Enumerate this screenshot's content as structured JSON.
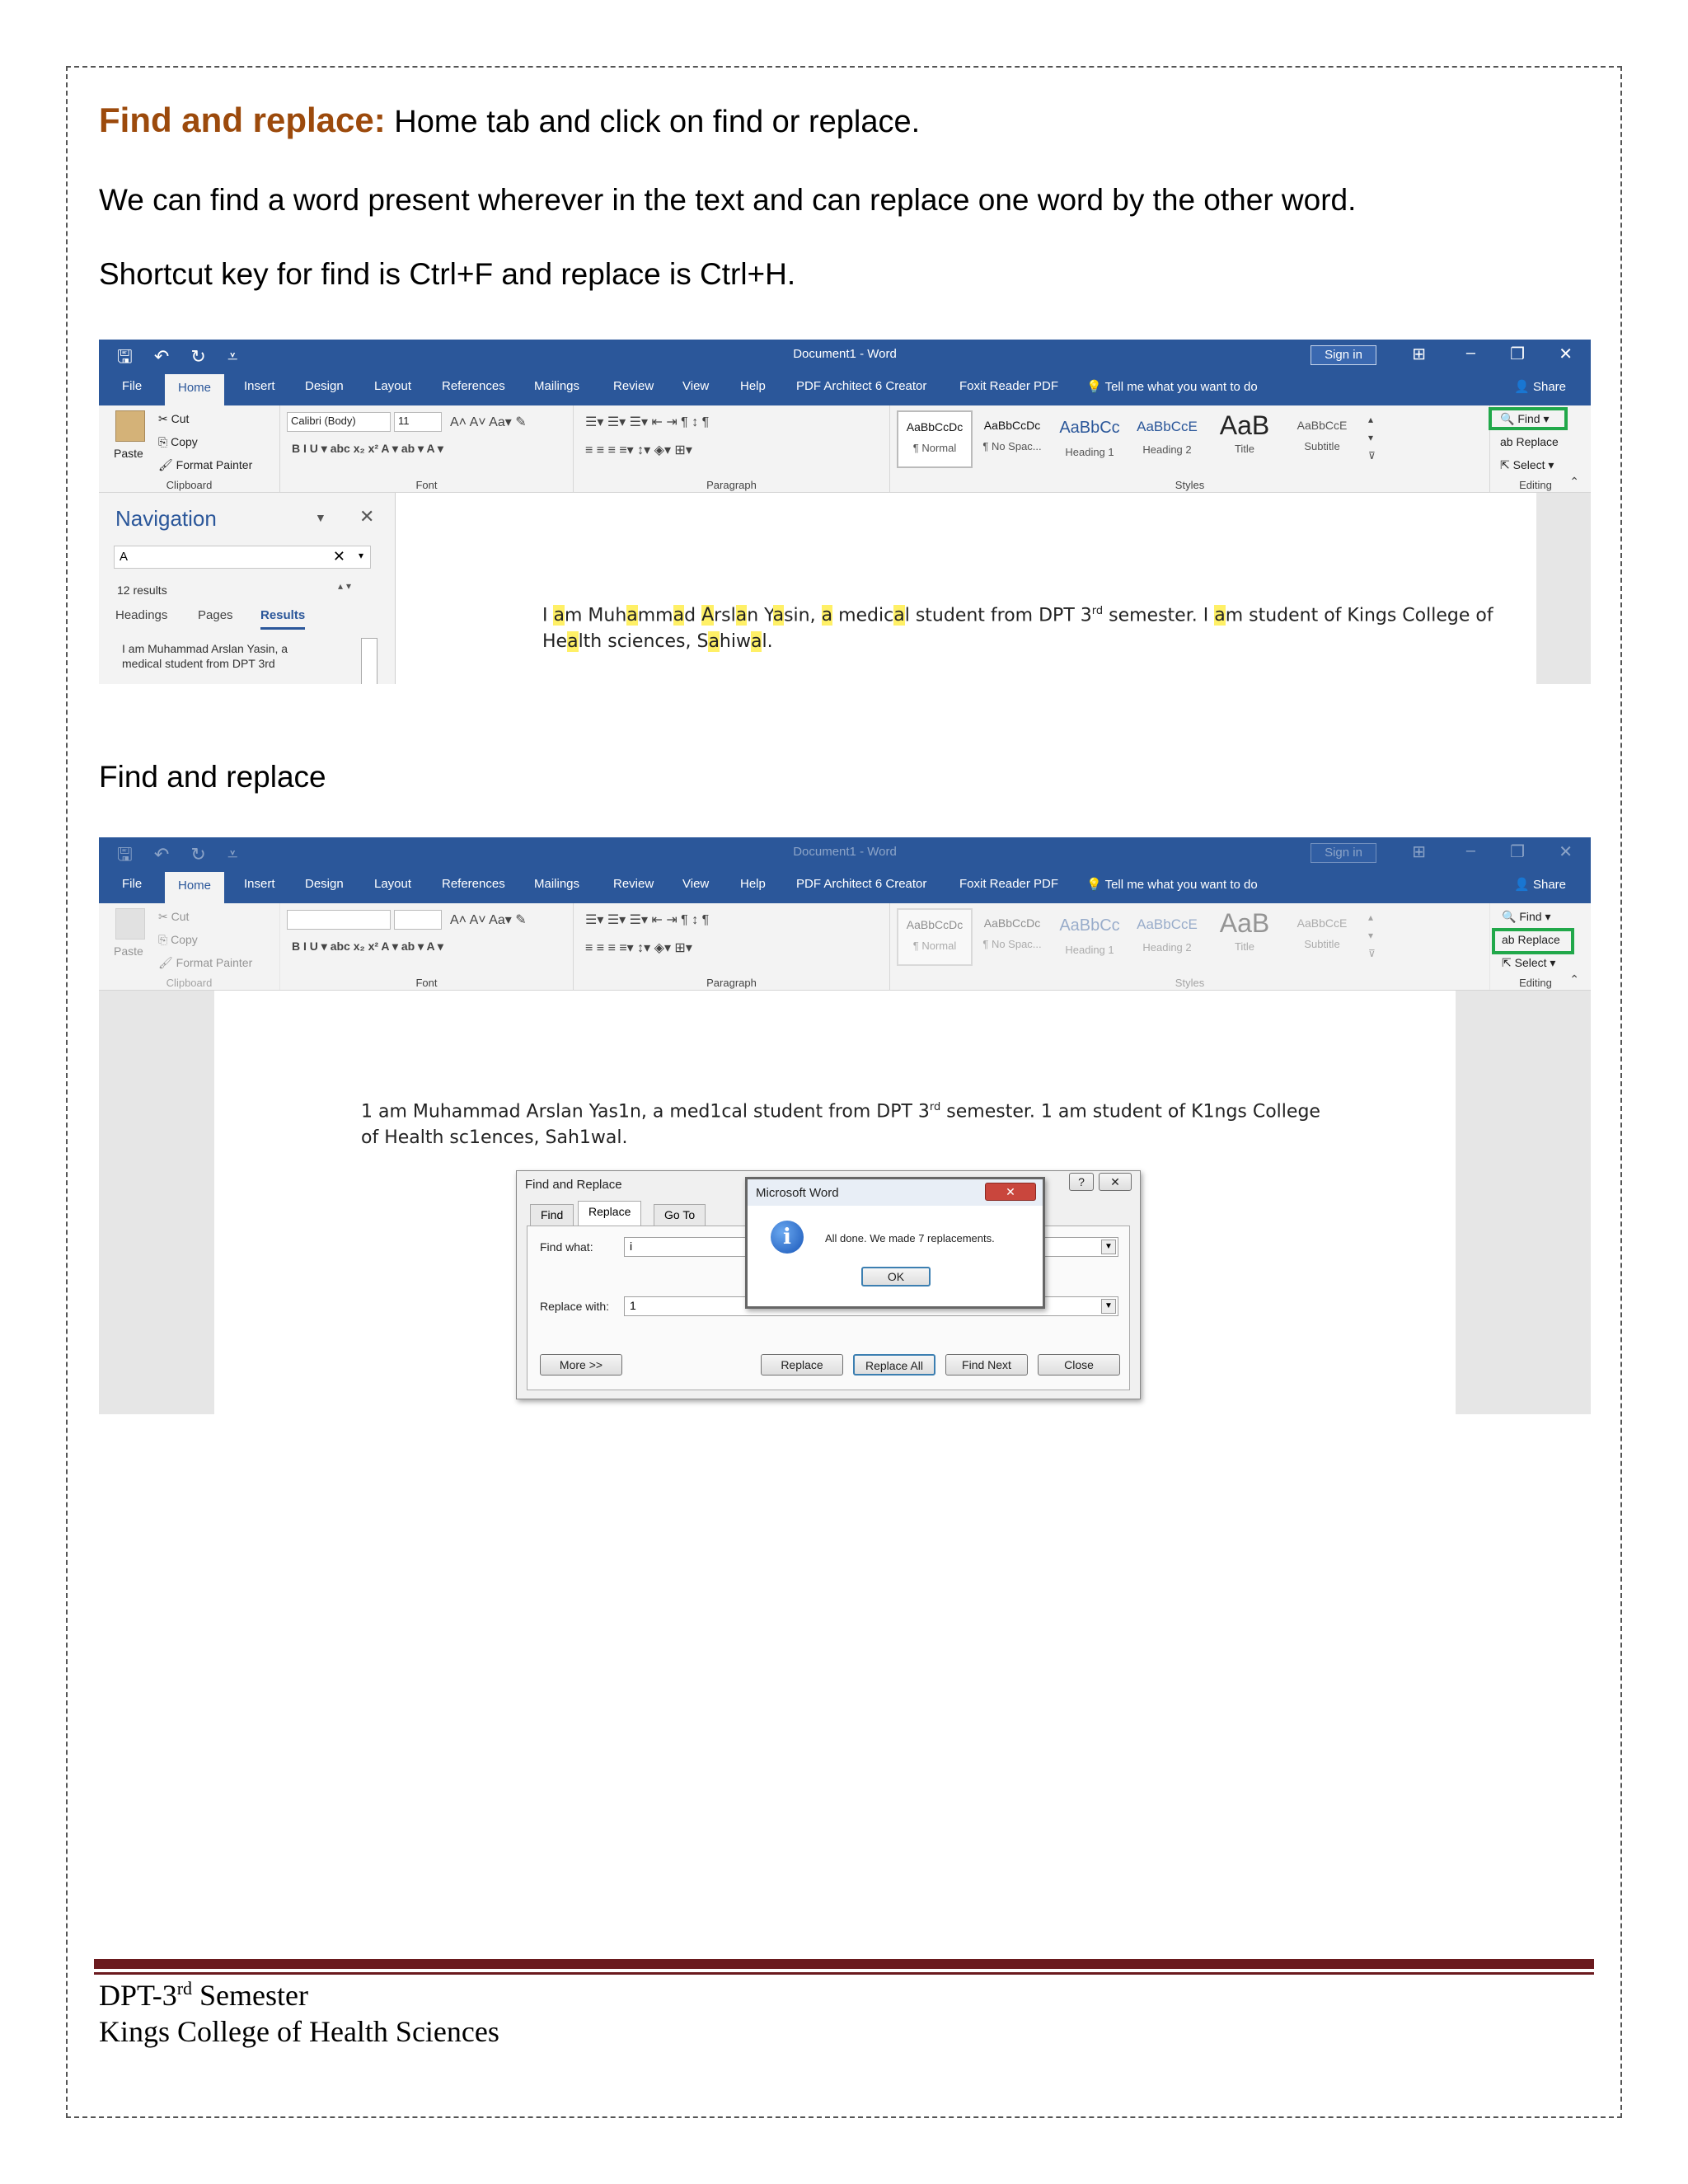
{
  "heading": {
    "highlight": "Find and replace:",
    "rest": " Home tab and click on find or replace."
  },
  "para1": "We can find a word present wherever in the text and can replace one word by the other word.",
  "para2": "Shortcut key for find is Ctrl+F and replace is Ctrl+H.",
  "caption": "Find and replace",
  "word": {
    "doc_title": "Document1  -  Word",
    "sign_in": "Sign in",
    "tabs": [
      "File",
      "Home",
      "Insert",
      "Design",
      "Layout",
      "References",
      "Mailings",
      "Review",
      "View",
      "Help",
      "PDF Architect 6 Creator",
      "Foxit Reader PDF"
    ],
    "tell_me": "Tell me what you want to do",
    "share": "Share",
    "clipboard": {
      "paste": "Paste",
      "cut": "Cut",
      "copy": "Copy",
      "format_painter": "Format Painter",
      "label": "Clipboard"
    },
    "font": {
      "name": "Calibri (Body)",
      "size": "11",
      "label": "Font"
    },
    "paragraph_label": "Paragraph",
    "styles": [
      {
        "sample": "AaBbCcDc",
        "name": "¶ Normal"
      },
      {
        "sample": "AaBbCcDc",
        "name": "¶ No Spac..."
      },
      {
        "sample": "AaBbCc",
        "name": "Heading 1"
      },
      {
        "sample": "AaBbCcE",
        "name": "Heading 2"
      },
      {
        "sample": "AaB",
        "name": "Title"
      },
      {
        "sample": "AaBbCcE",
        "name": "Subtitle"
      }
    ],
    "styles_label": "Styles",
    "editing": {
      "find": "Find",
      "replace": "Replace",
      "select": "Select",
      "label": "Editing"
    }
  },
  "nav": {
    "title": "Navigation",
    "search": "A",
    "results": "12 results",
    "tabs": [
      "Headings",
      "Pages",
      "Results"
    ],
    "snippet": "I am Muhammad Arslan Yasin, a medical student from DPT 3rd"
  },
  "doc1": {
    "l1_parts": [
      "I ",
      "a",
      "m Muh",
      "a",
      "mm",
      "a",
      "d ",
      "A",
      "rsl",
      "a",
      "n Y",
      "a",
      "sin, ",
      "a",
      " medic",
      "a",
      "l student from DPT 3",
      "rd",
      " semester. I ",
      "a",
      "m student of Kings College of"
    ],
    "l2_parts": [
      "He",
      "a",
      "lth sciences, S",
      "a",
      "hiw",
      "a",
      "l."
    ]
  },
  "doc2": {
    "line1": "1 am Muhammad Arslan Yas1n, a med1cal student from DPT 3",
    "sup": "rd",
    "line1b": " semester. 1 am student of K1ngs College",
    "line2": "of Health sc1ences, Sah1wal."
  },
  "find_replace": {
    "title": "Find and Replace",
    "tabs": [
      "Find",
      "Replace",
      "Go To"
    ],
    "find_label": "Find what:",
    "find_value": "i",
    "replace_label": "Replace with:",
    "replace_value": "1",
    "buttons": {
      "more": "More >>",
      "replace": "Replace",
      "replace_all": "Replace All",
      "find_next": "Find Next",
      "close": "Close"
    }
  },
  "msgbox": {
    "title": "Microsoft Word",
    "message": "All done. We made 7 replacements.",
    "ok": "OK"
  },
  "footer": {
    "line1a": "DPT-3",
    "line1sup": "rd",
    "line1b": " Semester",
    "line2": "Kings College of Health Sciences"
  }
}
